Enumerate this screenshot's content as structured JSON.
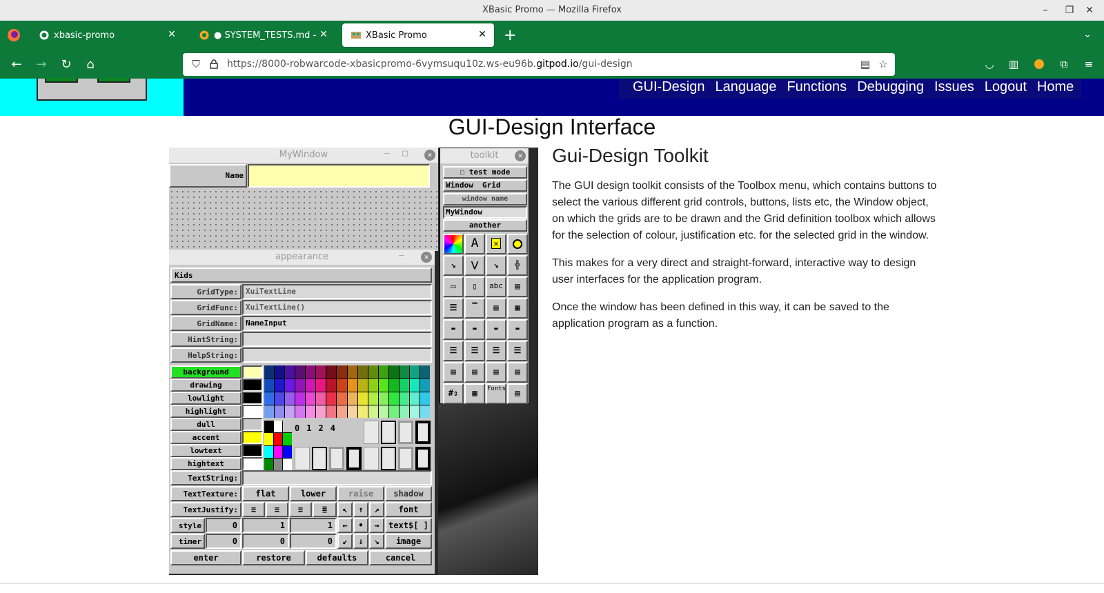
{
  "browser": {
    "window_title": "XBasic Promo — Mozilla Firefox",
    "tabs": [
      {
        "label": "xbasic-promo",
        "icon": "github-icon"
      },
      {
        "label": "● SYSTEM_TESTS.md - xbas",
        "icon": "gitpod-icon"
      },
      {
        "label": "XBasic Promo",
        "icon": "xbasic-icon",
        "active": true
      }
    ],
    "url_prefix": "https://8000-robwarcode-xbasicpromo-6vymsuqu10z.ws-eu96b.",
    "url_domain": "gitpod.io",
    "url_path": "/gui-design",
    "accent_color": "#0e7a3a"
  },
  "site": {
    "nav": [
      "GUI-Design",
      "Language",
      "Functions",
      "Debugging",
      "Issues",
      "Logout",
      "Home"
    ],
    "page_title": "GUI-Design Interface"
  },
  "article": {
    "heading": "Gui-Design Toolkit",
    "paragraphs": [
      "The GUI design toolkit consists of the Toolbox menu, which contains buttons to select the various different grid controls, buttons, lists etc, the Window object, on which the grids are to be drawn and the Grid definition toolbox which allows for the selection of colour, justification etc. for the selected grid in the window.",
      "This makes for a very direct and straight-forward, interactive way to design user interfaces for the application program.",
      "Once the window has been defined in this way, it can be saved to the application program as a function."
    ]
  },
  "xbasic": {
    "mywindow": {
      "title": "MyWindow",
      "name_label": "Name"
    },
    "appearance": {
      "title": "appearance",
      "kids": "Kids",
      "fields": [
        {
          "label": "GridType:",
          "value": "XuiTextLine"
        },
        {
          "label": "GridFunc:",
          "value": "XuiTextLine()"
        },
        {
          "label": "GridName:",
          "value": "NameInput"
        },
        {
          "label": "HintString:",
          "value": ""
        },
        {
          "label": "HelpString:",
          "value": ""
        }
      ],
      "color_rows": [
        "background",
        "drawing",
        "lowlight",
        "highlight",
        "dull",
        "accent",
        "lowtext",
        "hightext"
      ],
      "border_nums": [
        "0",
        "1",
        "2",
        "4"
      ],
      "textstring_label": "TextString:",
      "texture_label": "TextTexture:",
      "textures": [
        "flat",
        "lower",
        "raise",
        "shadow"
      ],
      "justify_label": "TextJustify:",
      "font_btn": "font",
      "style_label": "style",
      "style_vals": [
        "0",
        "1",
        "1"
      ],
      "textarr_btn": "text$[ ]",
      "timer_label": "timer",
      "timer_vals": [
        "0",
        "0",
        "0"
      ],
      "image_btn": "image",
      "bottom_buttons": [
        "enter",
        "restore",
        "defaults",
        "cancel"
      ]
    },
    "toolkit": {
      "title": "toolkit",
      "test_mode": "test mode",
      "menu": [
        "Window",
        "Grid"
      ],
      "window_name_label": "window name",
      "window_name": "MyWindow",
      "another": "another",
      "abc": "abc",
      "fonts": "Fonts"
    }
  }
}
